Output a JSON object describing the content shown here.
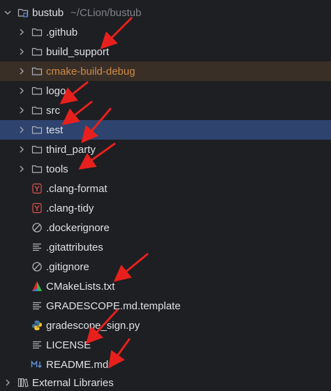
{
  "project": {
    "name": "bustub",
    "path": "~/CLion/bustub",
    "icon": "module-folder-icon",
    "expanded": true
  },
  "items": [
    {
      "label": ".github",
      "kind": "folder",
      "expandable": true,
      "state": "normal"
    },
    {
      "label": "build_support",
      "kind": "folder",
      "expandable": true,
      "state": "normal"
    },
    {
      "label": "cmake-build-debug",
      "kind": "folder",
      "expandable": true,
      "state": "excluded"
    },
    {
      "label": "logo",
      "kind": "folder",
      "expandable": true,
      "state": "normal"
    },
    {
      "label": "src",
      "kind": "folder",
      "expandable": true,
      "state": "normal"
    },
    {
      "label": "test",
      "kind": "folder",
      "expandable": true,
      "state": "selected"
    },
    {
      "label": "third_party",
      "kind": "folder",
      "expandable": true,
      "state": "normal"
    },
    {
      "label": "tools",
      "kind": "folder",
      "expandable": true,
      "state": "normal"
    },
    {
      "label": ".clang-format",
      "kind": "yaml",
      "expandable": false,
      "state": "normal"
    },
    {
      "label": ".clang-tidy",
      "kind": "yaml",
      "expandable": false,
      "state": "normal"
    },
    {
      "label": ".dockerignore",
      "kind": "ignore",
      "expandable": false,
      "state": "normal"
    },
    {
      "label": ".gitattributes",
      "kind": "text",
      "expandable": false,
      "state": "normal"
    },
    {
      "label": ".gitignore",
      "kind": "ignore",
      "expandable": false,
      "state": "normal"
    },
    {
      "label": "CMakeLists.txt",
      "kind": "cmake",
      "expandable": false,
      "state": "normal"
    },
    {
      "label": "GRADESCOPE.md.template",
      "kind": "text",
      "expandable": false,
      "state": "normal"
    },
    {
      "label": "gradescope_sign.py",
      "kind": "python",
      "expandable": false,
      "state": "normal"
    },
    {
      "label": "LICENSE",
      "kind": "text",
      "expandable": false,
      "state": "normal"
    },
    {
      "label": "README.md",
      "kind": "markdown",
      "expandable": false,
      "state": "normal"
    }
  ],
  "external_libraries": {
    "label": "External Libraries",
    "icon": "library-icon"
  },
  "colors": {
    "background": "#1e1f22",
    "selected": "#2e436e",
    "excluded_bg": "#3a2f27",
    "excluded_text": "#d08a47",
    "annotation_arrow": "#e8201d"
  },
  "annotations": {
    "arrow_count": 8,
    "arrow_color": "#e8201d"
  }
}
